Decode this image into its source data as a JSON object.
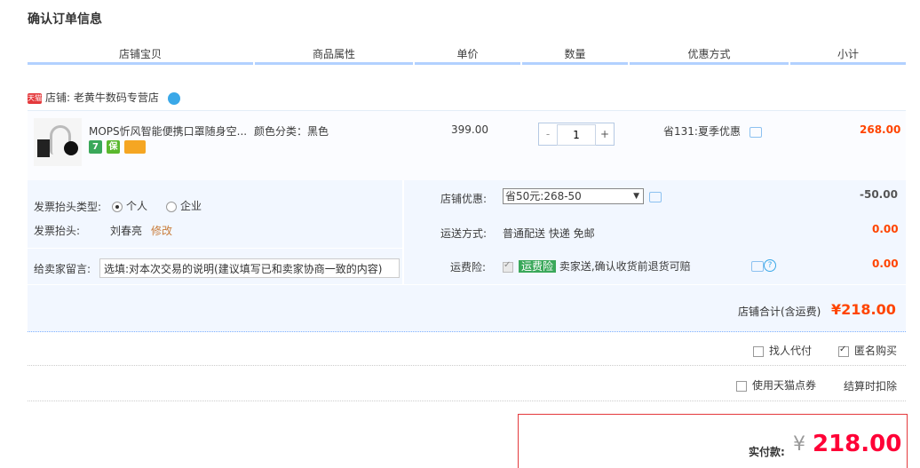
{
  "page_title": "确认订单信息",
  "columns": [
    "店铺宝贝",
    "商品属性",
    "单价",
    "数量",
    "优惠方式",
    "小计"
  ],
  "shop": {
    "badge": "天猫",
    "label": "店铺:",
    "name": "老黄牛数码专营店"
  },
  "item": {
    "title": "MOPS忻风智能便携口罩随身空...",
    "badges": [
      {
        "icon": "seven-day-return-icon",
        "text": "7",
        "color": "#3aa85a"
      },
      {
        "icon": "guarantee-icon",
        "text": "保",
        "color": "#5ab82e"
      },
      {
        "icon": "credit-card-icon",
        "text": "",
        "color": "#f5a623"
      }
    ],
    "attribute": "颜色分类：黑色",
    "price": "399.00",
    "quantity": "1",
    "qty_minus": "-",
    "qty_plus": "+",
    "discount": "省131:夏季优惠",
    "subtotal": "268.00"
  },
  "invoice": {
    "type_label": "发票抬头类型:",
    "option_personal": "个人",
    "option_company": "企业",
    "title_label": "发票抬头:",
    "title_value": "刘春亮",
    "edit_link": "修改"
  },
  "message": {
    "label": "给卖家留言:",
    "placeholder": "选填:对本次交易的说明(建议填写已和卖家协商一致的内容)"
  },
  "shop_discount": {
    "label": "店铺优惠:",
    "selected": "省50元:268-50",
    "amount": "-50.00"
  },
  "shipping": {
    "label": "运送方式:",
    "value": "普通配送 快递 免邮",
    "amount": "0.00"
  },
  "insurance": {
    "label": "运费险:",
    "tag": "运费险",
    "desc": "卖家送,确认收货前退货可赔",
    "amount": "0.00"
  },
  "shop_total": {
    "label": "店铺合计(含运费)",
    "value": "¥218.00"
  },
  "options": {
    "find_payer": "找人代付",
    "anonymous": "匿名购买",
    "tmall_points": "使用天猫点券",
    "points_note": "结算时扣除"
  },
  "payment": {
    "label": "实付款:",
    "currency": "¥",
    "amount": "218.00"
  },
  "colors": {
    "accent_red": "#f40",
    "header_bar": "#b2d1ff",
    "panel_bg": "#f2f7ff"
  }
}
